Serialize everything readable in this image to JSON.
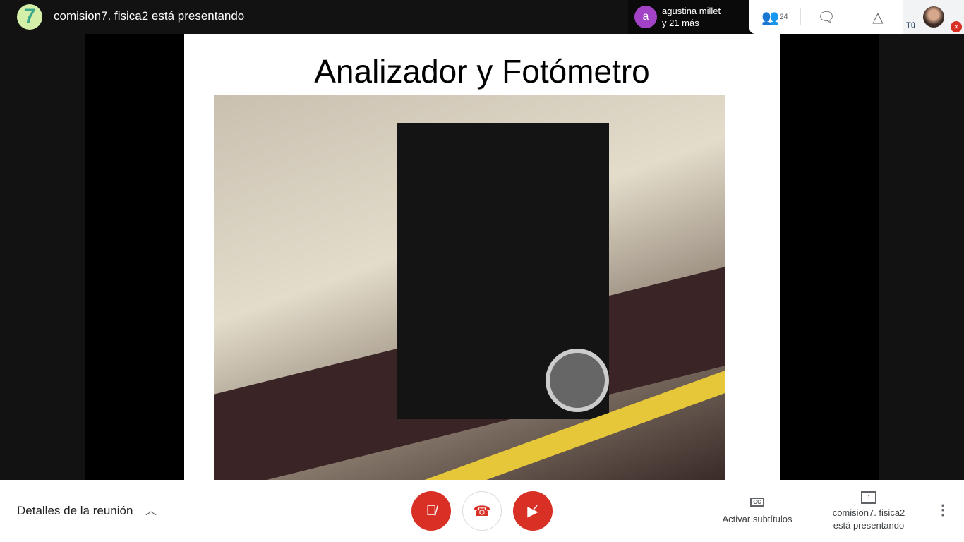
{
  "header": {
    "logo_text": "7",
    "title": "comision7. fisica2 está presentando"
  },
  "presenter": {
    "avatar_letter": "a",
    "line1": "agustina millet",
    "line2": "y 21 más"
  },
  "toolbar": {
    "participant_count": "24",
    "self_label": "Tú"
  },
  "slide": {
    "title": "Analizador y Fotómetro"
  },
  "bottom": {
    "details_label": "Detalles de la reunión",
    "captions_label": "Activar subtítulos",
    "cc_icon": "CC",
    "presenting_line1": "comision7. fisica2",
    "presenting_line2": "está presentando"
  },
  "colors": {
    "accent_red": "#d93025",
    "presenter_avatar": "#a142c7"
  }
}
